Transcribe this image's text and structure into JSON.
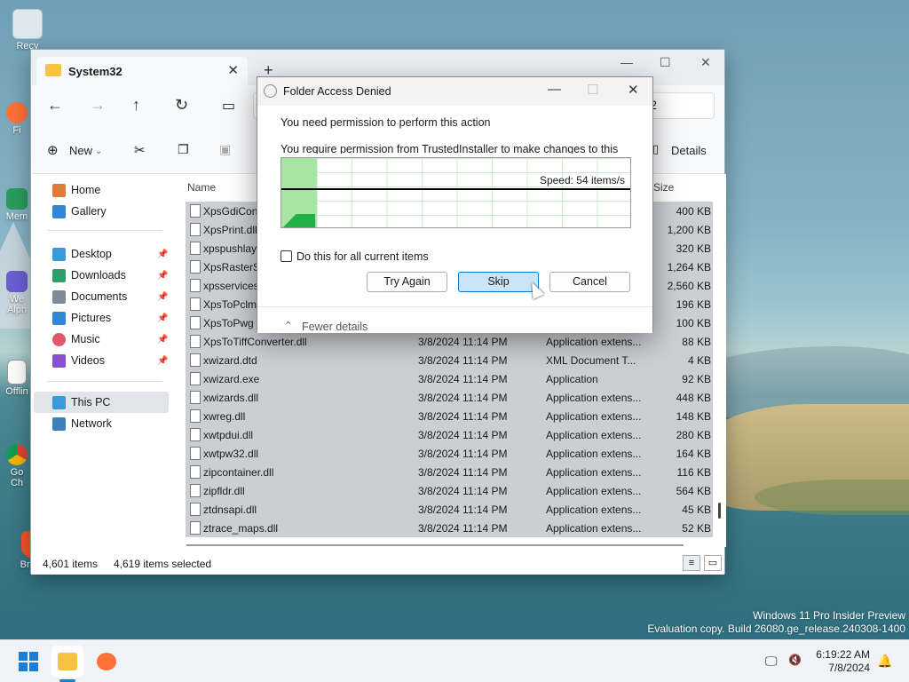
{
  "desktop": {
    "icons": [
      {
        "label": "Recy"
      },
      {
        "label": "Fi"
      },
      {
        "label": "Mem"
      },
      {
        "label": "We Alph"
      },
      {
        "label": "Offlin"
      },
      {
        "label": "Go Ch"
      },
      {
        "label": "Brave"
      }
    ],
    "watermark_line1": "Windows 11 Pro Insider Preview",
    "watermark_line2": "Evaluation copy. Build 26080.ge_release.240308-1400"
  },
  "explorer": {
    "tab_title": "System32",
    "address_tail": "em32",
    "toolbar": {
      "new_label": "New",
      "details_label": "Details"
    },
    "sidebar": {
      "items": [
        {
          "label": "Home",
          "pinned": false
        },
        {
          "label": "Gallery",
          "pinned": false
        },
        {
          "label": "Desktop",
          "pinned": true
        },
        {
          "label": "Downloads",
          "pinned": true
        },
        {
          "label": "Documents",
          "pinned": true
        },
        {
          "label": "Pictures",
          "pinned": true
        },
        {
          "label": "Music",
          "pinned": true
        },
        {
          "label": "Videos",
          "pinned": true
        },
        {
          "label": "This PC",
          "pinned": false
        },
        {
          "label": "Network",
          "pinned": false
        }
      ]
    },
    "columns": {
      "name": "Name",
      "size": "Size"
    },
    "files": [
      {
        "name": "XpsGdiCon",
        "date": "",
        "type": "",
        "size": "400 KB"
      },
      {
        "name": "XpsPrint.dll",
        "date": "",
        "type": "",
        "size": "1,200 KB"
      },
      {
        "name": "xpspushlay",
        "date": "",
        "type": "",
        "size": "320 KB"
      },
      {
        "name": "XpsRasterS",
        "date": "",
        "type": "",
        "size": "1,264 KB"
      },
      {
        "name": "xpsservices",
        "date": "",
        "type": "",
        "size": "2,560 KB"
      },
      {
        "name": "XpsToPclm",
        "date": "",
        "type": "",
        "size": "196 KB"
      },
      {
        "name": "XpsToPwg",
        "date": "",
        "type": "",
        "size": "100 KB"
      },
      {
        "name": "XpsToTiffConverter.dll",
        "date": "3/8/2024 11:14 PM",
        "type": "Application extens...",
        "size": "88 KB"
      },
      {
        "name": "xwizard.dtd",
        "date": "3/8/2024 11:14 PM",
        "type": "XML Document T...",
        "size": "4 KB"
      },
      {
        "name": "xwizard.exe",
        "date": "3/8/2024 11:14 PM",
        "type": "Application",
        "size": "92 KB"
      },
      {
        "name": "xwizards.dll",
        "date": "3/8/2024 11:14 PM",
        "type": "Application extens...",
        "size": "448 KB"
      },
      {
        "name": "xwreg.dll",
        "date": "3/8/2024 11:14 PM",
        "type": "Application extens...",
        "size": "148 KB"
      },
      {
        "name": "xwtpdui.dll",
        "date": "3/8/2024 11:14 PM",
        "type": "Application extens...",
        "size": "280 KB"
      },
      {
        "name": "xwtpw32.dll",
        "date": "3/8/2024 11:14 PM",
        "type": "Application extens...",
        "size": "164 KB"
      },
      {
        "name": "zipcontainer.dll",
        "date": "3/8/2024 11:14 PM",
        "type": "Application extens...",
        "size": "116 KB"
      },
      {
        "name": "zipfldr.dll",
        "date": "3/8/2024 11:14 PM",
        "type": "Application extens...",
        "size": "564 KB"
      },
      {
        "name": "ztdnsapi.dll",
        "date": "3/8/2024 11:14 PM",
        "type": "Application extens...",
        "size": "45 KB"
      },
      {
        "name": "ztrace_maps.dll",
        "date": "3/8/2024 11:14 PM",
        "type": "Application extens...",
        "size": "52 KB"
      }
    ],
    "status": {
      "items": "4,601 items",
      "selected": "4,619 items selected"
    }
  },
  "dialog": {
    "title": "Folder Access Denied",
    "message1": "You need permission to perform this action",
    "message2": "You require permission from TrustedInstaller to make changes to this",
    "speed": "Speed: 54 items/s",
    "checkbox_label": "Do this for all current items",
    "checkbox_checked": false,
    "buttons": {
      "try_again": "Try Again",
      "skip": "Skip",
      "cancel": "Cancel"
    },
    "fewer_details": "Fewer details"
  },
  "taskbar": {
    "time": "6:19:22 AM",
    "date": "7/8/2024"
  }
}
